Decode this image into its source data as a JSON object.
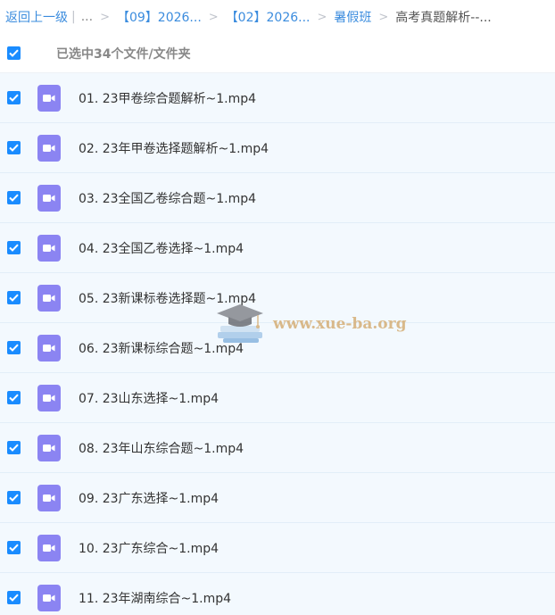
{
  "breadcrumb": {
    "back_label": "返回上一级",
    "divider": "|",
    "ellipsis": "...",
    "items": [
      {
        "label": "【09】2026..."
      },
      {
        "label": "【02】2026..."
      },
      {
        "label": "暑假班"
      }
    ],
    "current": "高考真题解析--..."
  },
  "selection": {
    "label": "已选中34个文件/文件夹"
  },
  "files": [
    {
      "name": "01. 23甲卷综合题解析~1.mp4"
    },
    {
      "name": "02. 23年甲卷选择题解析~1.mp4"
    },
    {
      "name": "03. 23全国乙卷综合题~1.mp4"
    },
    {
      "name": "04. 23全国乙卷选择~1.mp4"
    },
    {
      "name": "05. 23新课标卷选择题~1.mp4"
    },
    {
      "name": "06. 23新课标综合题~1.mp4"
    },
    {
      "name": "07. 23山东选择~1.mp4"
    },
    {
      "name": "08. 23年山东综合题~1.mp4"
    },
    {
      "name": "09. 23广东选择~1.mp4"
    },
    {
      "name": "10. 23广东综合~1.mp4"
    },
    {
      "name": "11. 23年湖南综合~1.mp4"
    }
  ],
  "watermark": {
    "text": "www.xue-ba.org"
  },
  "colors": {
    "accent": "#1a8cff",
    "link": "#3b8cde",
    "video_icon": "#8b84f2",
    "row_bg": "#f3f9fe"
  }
}
